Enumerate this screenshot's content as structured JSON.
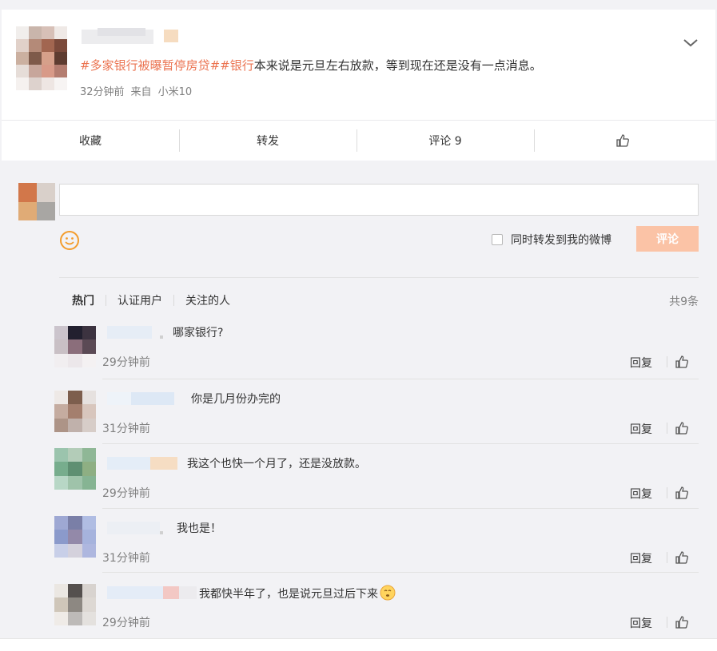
{
  "post": {
    "tag1": "#多家银行被曝暂停房贷#",
    "tag2": "#银行",
    "text": "本来说是元旦左右放款，等到现在还是没有一点消息。",
    "time": "32分钟前",
    "source_prefix": "来自",
    "source": "小米10"
  },
  "actions": {
    "favorite": "收藏",
    "repost": "转发",
    "comment": "评论 9"
  },
  "compose": {
    "placeholder": "",
    "repost_label": "同时转发到我的微博",
    "submit": "评论"
  },
  "tabs": [
    "热门",
    "认证用户",
    "关注的人"
  ],
  "count": "共9条",
  "comments": [
    {
      "text": "哪家银行?",
      "time": "29分钟前",
      "reply": "回复"
    },
    {
      "text": "你是几月份办完的",
      "time": "31分钟前",
      "reply": "回复"
    },
    {
      "text": "我这个也快一个月了，还是没放款。",
      "time": "29分钟前",
      "reply": "回复"
    },
    {
      "text": "我也是！",
      "time": "31分钟前",
      "reply": "回复"
    },
    {
      "text": "我都快半年了，也是说元旦过后下来",
      "time": "29分钟前",
      "reply": "回复"
    }
  ],
  "colors": {
    "tag": "#eb7350",
    "submit": "#fbc3a6",
    "meta": "#808080"
  }
}
